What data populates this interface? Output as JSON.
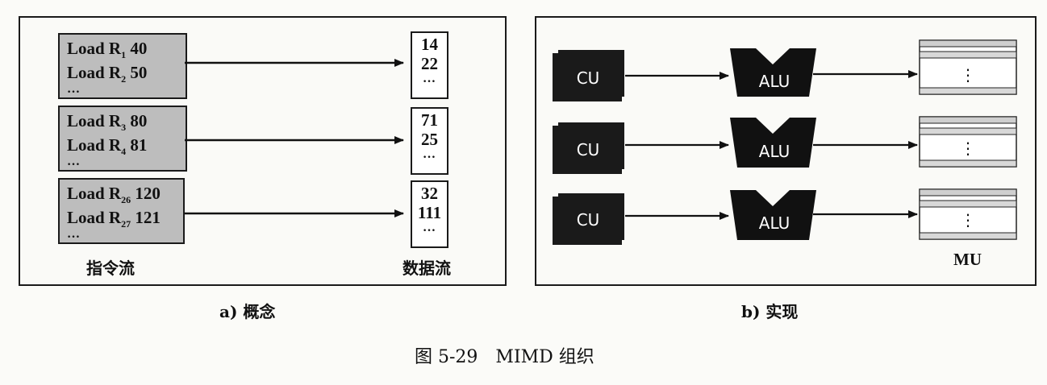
{
  "panel_a": {
    "instruction_boxes": [
      {
        "line1": {
          "prefix": "Load R",
          "sub": "1",
          "value": " 40"
        },
        "line2": {
          "prefix": "Load R",
          "sub": "2",
          "value": " 50"
        },
        "ellipsis": "…"
      },
      {
        "line1": {
          "prefix": "Load R",
          "sub": "3",
          "value": " 80"
        },
        "line2": {
          "prefix": "Load R",
          "sub": "4",
          "value": " 81"
        },
        "ellipsis": "…"
      },
      {
        "line1": {
          "prefix": "Load R",
          "sub": "26",
          "value": " 120"
        },
        "line2": {
          "prefix": "Load R",
          "sub": "27",
          "value": " 121"
        },
        "ellipsis": "…"
      }
    ],
    "data_boxes": [
      {
        "v1": "14",
        "v2": "22",
        "ellipsis": "…"
      },
      {
        "v1": "71",
        "v2": "25",
        "ellipsis": "…"
      },
      {
        "v1": "32",
        "v2": "111",
        "ellipsis": "…"
      }
    ],
    "instruction_stream_label": "指令流",
    "data_stream_label": "数据流",
    "caption": "a) 概念"
  },
  "panel_b": {
    "cu_label": "CU",
    "alu_label": "ALU",
    "memory_ellipsis": "⋮",
    "mu_label": "MU",
    "caption": "b) 实现"
  },
  "figure_title": "图 5-29　MIMD 组织"
}
